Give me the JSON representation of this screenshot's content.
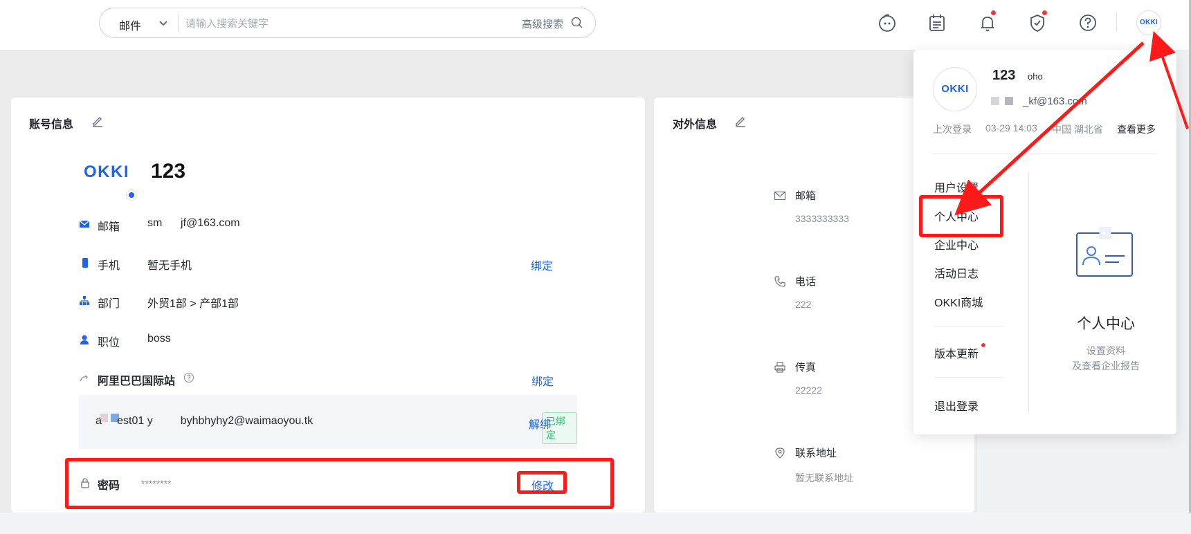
{
  "search": {
    "type_label": "邮件",
    "placeholder": "请输入搜索关键字",
    "advanced_label": "高级搜索"
  },
  "toolbar": {
    "icons": [
      "assistant-icon",
      "calendar-icon",
      "bell-icon",
      "shield-icon",
      "help-icon"
    ],
    "avatar_text": "OKKI"
  },
  "account": {
    "title": "账号信息",
    "logo_text": "OKKI",
    "name": "123",
    "rows": [
      {
        "label": "邮箱",
        "value": "sm      jf@163.com",
        "action": ""
      },
      {
        "label": "手机",
        "value": "暂无手机",
        "action": "绑定"
      },
      {
        "label": "部门",
        "value": "外贸1部 > 产部1部",
        "action": ""
      },
      {
        "label": "职位",
        "value": "boss",
        "action": ""
      }
    ],
    "alibaba": {
      "label": "阿里巴巴国际站",
      "bind_action": "绑定",
      "account_text": "a     est01 y         byhbhyhy2@waimaoyou.tk",
      "bound_badge": "已绑定",
      "unbind_action": "解绑"
    },
    "password": {
      "label": "密码",
      "value": "********",
      "action": "修改"
    }
  },
  "external": {
    "title": "对外信息",
    "fields": [
      {
        "label": "邮箱",
        "value": "3333333333"
      },
      {
        "label": "电话",
        "value": "222"
      },
      {
        "label": "传真",
        "value": "22222"
      },
      {
        "label": "联系地址",
        "value": "暂无联系地址"
      }
    ]
  },
  "dropdown": {
    "avatar_text": "OKKI",
    "name": "123",
    "name_suffix": "oho",
    "email": "_kf@163.com",
    "last_login_label": "上次登录",
    "last_login_time": "03-29 14:03",
    "last_login_location": "中国 湖北省",
    "view_more": "查看更多",
    "menu": {
      "user_settings": "用户设置",
      "personal_center": "个人中心",
      "enterprise_center": "企业中心",
      "activity_log": "活动日志",
      "okki_mall": "OKKI商城",
      "version_update": "版本更新",
      "logout": "退出登录"
    },
    "preview": {
      "title": "个人中心",
      "desc_line1": "设置资料",
      "desc_line2": "及查看企业报告"
    }
  },
  "colors": {
    "accent": "#1e63e9",
    "highlight": "#ff1a1a",
    "badge_green": "#2fbd6b",
    "notification": "#ee3b3b"
  }
}
